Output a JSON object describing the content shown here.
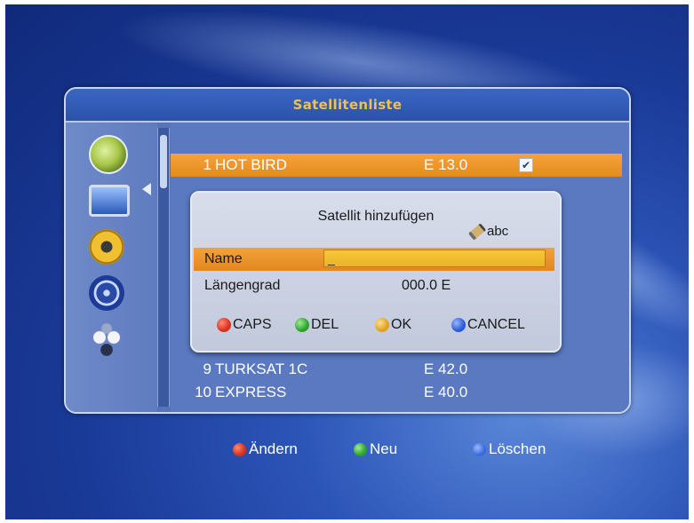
{
  "panel": {
    "title": "Satellitenliste"
  },
  "sidebar": {
    "icons": [
      {
        "name": "satellite-dish-icon",
        "color": "#a8c84a"
      },
      {
        "name": "tv-monitor-icon",
        "color": "#4a7ac8"
      },
      {
        "name": "gear-icon",
        "color": "#e0b020"
      },
      {
        "name": "film-reel-icon",
        "color": "#3a5ab0"
      },
      {
        "name": "network-icon",
        "color": "#c0c8d8"
      }
    ]
  },
  "satellites": [
    {
      "num": "1",
      "name": "HOT BIRD",
      "position": "E 13.0",
      "checked": "✔",
      "selected": true
    },
    {
      "num": "9",
      "name": "TURKSAT 1C",
      "position": "E 42.0",
      "checked": "",
      "selected": false
    },
    {
      "num": "10",
      "name": "EXPRESS",
      "position": "E 40.0",
      "checked": "",
      "selected": false
    }
  ],
  "dialog": {
    "title": "Satellit hinzufügen",
    "input_mode": "abc",
    "name_label": "Name",
    "name_value": "_",
    "longitude_label": "Längengrad",
    "longitude_value": "000.0 E",
    "buttons": [
      {
        "label": "CAPS",
        "color": "#d83020"
      },
      {
        "label": "DEL",
        "color": "#2ea030"
      },
      {
        "label": "OK",
        "color": "#e0a020"
      },
      {
        "label": "CANCEL",
        "color": "#2a5ad8"
      }
    ]
  },
  "footer": {
    "buttons": [
      {
        "label": "Ändern",
        "color": "#d83020"
      },
      {
        "label": "Neu",
        "color": "#2ea030"
      },
      {
        "label": "Löschen",
        "color": "#3a6ae0"
      }
    ]
  }
}
